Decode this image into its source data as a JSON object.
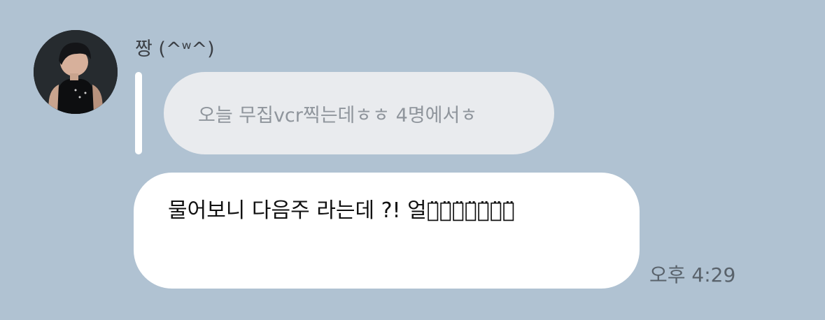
{
  "chat": {
    "sender": {
      "name": "짱 (^ʷ^)"
    },
    "reply": {
      "quoted_text": "오늘 무집vcr찍는데ㅎㅎ 4명에서ㅎ"
    },
    "message": {
      "text": "물어보니 다음주 라는데 ?!  얼ㅋ̈ㅋ̈ㅋ̈ㅋ̈ㅋ̈ㅋ̈ㅋ̈",
      "time": "오후 4:29"
    }
  },
  "colors": {
    "background": "#b0c2d2",
    "bubble": "#ffffff",
    "quoted_bubble": "#e9ebee"
  }
}
